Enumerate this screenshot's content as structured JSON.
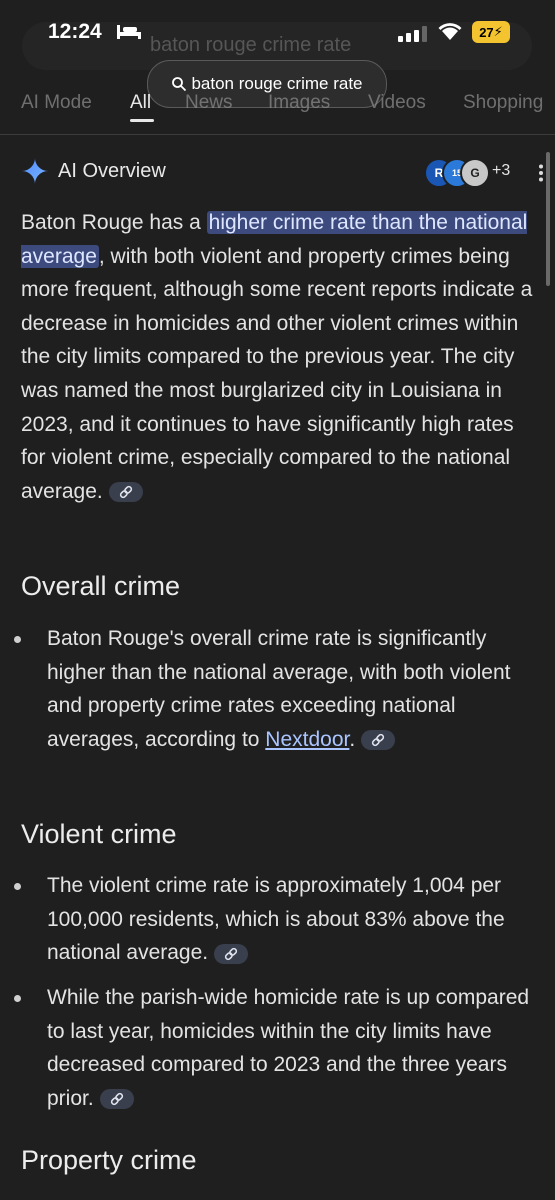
{
  "status_bar": {
    "time": "12:24",
    "battery": "27"
  },
  "search": {
    "ghost_query": "baton rouge crime rate",
    "query": "baton rouge crime rate"
  },
  "tabs": [
    {
      "label": "AI Mode"
    },
    {
      "label": "All"
    },
    {
      "label": "News"
    },
    {
      "label": "Images"
    },
    {
      "label": "Videos"
    },
    {
      "label": "Shopping"
    }
  ],
  "ai_overview": {
    "title": "AI Overview",
    "sources": {
      "avatar1": "R",
      "avatar2": "15",
      "avatar3": "G",
      "more": "+3"
    },
    "intro": {
      "before": "Baton Rouge has a ",
      "highlight": "higher crime rate than the national average",
      "after": ", with both violent and property crimes being more frequent, although some recent reports indicate a decrease in homicides and other violent crimes within the city limits compared to the previous year. The city was named the most burglarized city in Louisiana in 2023, and it continues to have significantly high rates for violent crime, especially compared to the national average."
    },
    "sections": [
      {
        "heading": "Overall crime",
        "bullets": [
          {
            "text": "Baton Rouge's overall crime rate is significantly higher than the national average, with both violent and property crime rates exceeding national averages, according to ",
            "link": "Nextdoor",
            "after": "."
          }
        ]
      },
      {
        "heading": "Violent crime",
        "bullets": [
          {
            "text": "The violent crime rate is approximately 1,004 per 100,000 residents, which is about 83% above the national average."
          },
          {
            "text": "While the parish-wide homicide rate is up compared to last year, homicides within the city limits have decreased compared to 2023 and the three years prior."
          }
        ]
      },
      {
        "heading": "Property crime"
      }
    ]
  },
  "colors": {
    "background": "#1f1f1f",
    "highlight": "#3c4a7e",
    "link": "#a9c4ff"
  }
}
